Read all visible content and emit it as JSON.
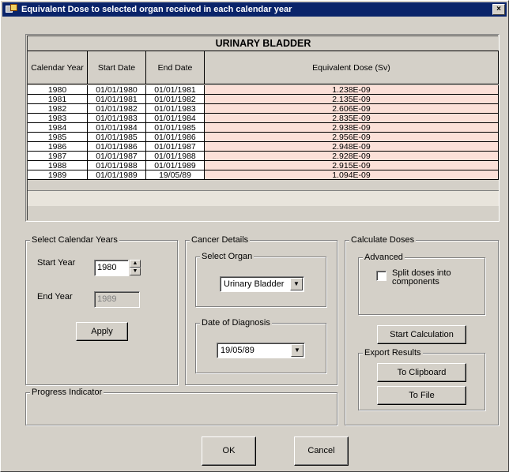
{
  "window": {
    "title": "Equivalent Dose to selected organ received in each calendar year",
    "close_glyph": "×"
  },
  "grid": {
    "title": "URINARY BLADDER",
    "headers": [
      "Calendar Year",
      "Start Date",
      "End Date",
      "Equivalent Dose (Sv)"
    ],
    "rows": [
      {
        "year": "1980",
        "start": "01/01/1980",
        "end": "01/01/1981",
        "dose": "1.238E-09"
      },
      {
        "year": "1981",
        "start": "01/01/1981",
        "end": "01/01/1982",
        "dose": "2.135E-09"
      },
      {
        "year": "1982",
        "start": "01/01/1982",
        "end": "01/01/1983",
        "dose": "2.606E-09"
      },
      {
        "year": "1983",
        "start": "01/01/1983",
        "end": "01/01/1984",
        "dose": "2.835E-09"
      },
      {
        "year": "1984",
        "start": "01/01/1984",
        "end": "01/01/1985",
        "dose": "2.938E-09"
      },
      {
        "year": "1985",
        "start": "01/01/1985",
        "end": "01/01/1986",
        "dose": "2.956E-09"
      },
      {
        "year": "1986",
        "start": "01/01/1986",
        "end": "01/01/1987",
        "dose": "2.948E-09"
      },
      {
        "year": "1987",
        "start": "01/01/1987",
        "end": "01/01/1988",
        "dose": "2.928E-09"
      },
      {
        "year": "1988",
        "start": "01/01/1988",
        "end": "01/01/1989",
        "dose": "2.915E-09"
      },
      {
        "year": "1989",
        "start": "01/01/1989",
        "end": "19/05/89",
        "dose": "1.094E-09"
      }
    ]
  },
  "select_years": {
    "group_label": "Select Calendar Years",
    "start_label": "Start Year",
    "start_value": "1980",
    "end_label": "End Year",
    "end_value": "1989",
    "apply_label": "Apply"
  },
  "cancer_details": {
    "group_label": "Cancer Details",
    "organ_group_label": "Select Organ",
    "organ_value": "Urinary Bladder",
    "diagnosis_group_label": "Date of Diagnosis",
    "diagnosis_value": "19/05/89"
  },
  "calculate": {
    "group_label": "Calculate Doses",
    "advanced_label": "Advanced",
    "split_label_line1": "Split doses into",
    "split_label_line2": "components",
    "split_checked": false,
    "start_calc_label": "Start Calculation",
    "export_label": "Export Results",
    "clipboard_label": "To Clipboard",
    "file_label": "To File"
  },
  "progress": {
    "group_label": "Progress Indicator"
  },
  "footer": {
    "ok_label": "OK",
    "cancel_label": "Cancel"
  },
  "colors": {
    "titlebar": "#0a246a",
    "dose_cell_bg": "#fbe0d8",
    "dialog_bg": "#d4d0c8"
  }
}
